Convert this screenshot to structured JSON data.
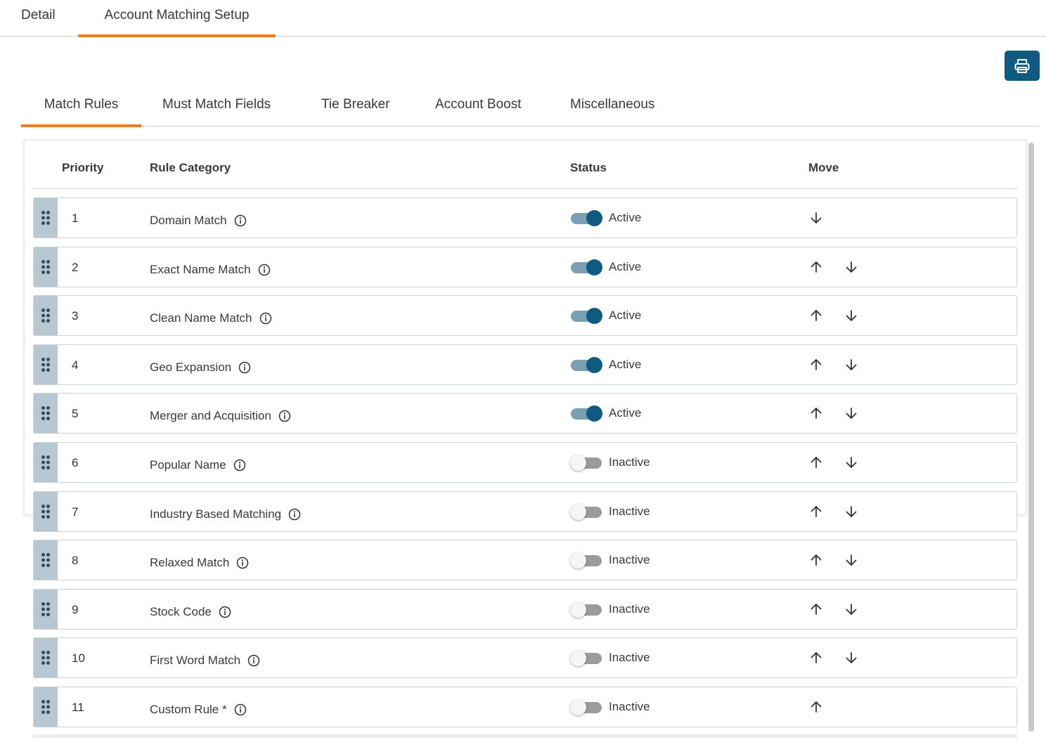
{
  "top_tabs": [
    "Detail",
    "Account Matching Setup"
  ],
  "sub_tabs": [
    "Match Rules",
    "Must Match Fields",
    "Tie Breaker",
    "Account Boost",
    "Miscellaneous"
  ],
  "print_button": {
    "icon": "printer-icon"
  },
  "table": {
    "headers": {
      "priority": "Priority",
      "rule_category": "Rule Category",
      "status": "Status",
      "move": "Move"
    },
    "rows": [
      {
        "priority": "1",
        "rule": "Domain Match",
        "active": true,
        "status": "Active",
        "moves": [
          "down"
        ]
      },
      {
        "priority": "2",
        "rule": "Exact Name Match",
        "active": true,
        "status": "Active",
        "moves": [
          "up",
          "down"
        ]
      },
      {
        "priority": "3",
        "rule": "Clean Name Match",
        "active": true,
        "status": "Active",
        "moves": [
          "up",
          "down"
        ]
      },
      {
        "priority": "4",
        "rule": "Geo Expansion",
        "active": true,
        "status": "Active",
        "moves": [
          "up",
          "down"
        ]
      },
      {
        "priority": "5",
        "rule": "Merger and Acquisition",
        "active": true,
        "status": "Active",
        "moves": [
          "up",
          "down"
        ]
      },
      {
        "priority": "6",
        "rule": "Popular Name",
        "active": false,
        "status": "Inactive",
        "moves": [
          "up",
          "down"
        ]
      },
      {
        "priority": "7",
        "rule": "Industry Based Matching",
        "active": false,
        "status": "Inactive",
        "moves": [
          "up",
          "down"
        ]
      },
      {
        "priority": "8",
        "rule": "Relaxed Match",
        "active": false,
        "status": "Inactive",
        "moves": [
          "up",
          "down"
        ]
      },
      {
        "priority": "9",
        "rule": "Stock Code",
        "active": false,
        "status": "Inactive",
        "moves": [
          "up",
          "down"
        ]
      },
      {
        "priority": "10",
        "rule": "First Word Match",
        "active": false,
        "status": "Inactive",
        "moves": [
          "up",
          "down"
        ]
      },
      {
        "priority": "11",
        "rule": "Custom Rule *",
        "active": false,
        "status": "Inactive",
        "moves": [
          "up"
        ]
      }
    ]
  },
  "colors": {
    "accent": "#f07a1e",
    "primary": "#0e5a80",
    "handle": "#b8c8d2",
    "toggle_on_track": "#7a9fb3"
  }
}
